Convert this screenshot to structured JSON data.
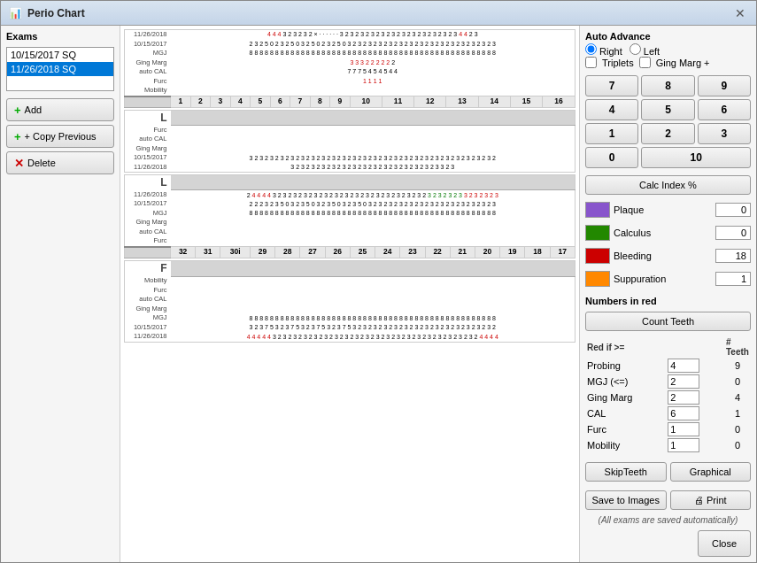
{
  "window": {
    "title": "Perio Chart",
    "icon": "📊"
  },
  "left_panel": {
    "exams_label": "Exams",
    "exam_items": [
      {
        "label": "10/15/2017  SQ",
        "selected": false
      },
      {
        "label": "11/26/2018  SQ",
        "selected": true
      }
    ],
    "add_btn": "Add",
    "copy_btn": "+ Copy Previous",
    "delete_btn": "Delete"
  },
  "right_panel": {
    "auto_advance_label": "Auto Advance",
    "right_label": "Right",
    "left_label": "Left",
    "triplets_label": "Triplets",
    "ging_marg_plus_label": "Ging Marg +",
    "numpad_keys": [
      "7",
      "8",
      "9",
      "4",
      "5",
      "6",
      "1",
      "2",
      "3",
      "0",
      "10"
    ],
    "calc_btn": "Calc Index %",
    "plaque_label": "Plaque",
    "plaque_value": "0",
    "plaque_color": "#8855cc",
    "calculus_label": "Calculus",
    "calculus_value": "0",
    "calculus_color": "#228800",
    "bleeding_label": "Bleeding",
    "bleeding_value": "18",
    "bleeding_color": "#cc0000",
    "suppuration_label": "Suppuration",
    "suppuration_value": "1",
    "suppuration_color": "#ff8800",
    "numbers_in_red_label": "Numbers in red",
    "count_teeth_btn": "Count Teeth",
    "red_if_label": "Red if >=",
    "teeth_label": "# Teeth",
    "red_rows": [
      {
        "label": "Probing",
        "value": "4",
        "teeth": "9"
      },
      {
        "label": "MGJ (<=)",
        "value": "2",
        "teeth": "0"
      },
      {
        "label": "Ging Marg",
        "value": "2",
        "teeth": "4"
      },
      {
        "label": "CAL",
        "value": "6",
        "teeth": "1"
      },
      {
        "label": "Furc",
        "value": "1",
        "teeth": "0"
      },
      {
        "label": "Mobility",
        "value": "1",
        "teeth": "0"
      }
    ],
    "skip_teeth_btn": "SkipTeeth",
    "graphical_btn": "Graphical",
    "save_to_images_btn": "Save to Images",
    "print_btn": "Print",
    "auto_save_note": "(All exams are saved automatically)"
  },
  "chart": {
    "upper_teeth_numbers": [
      "1",
      "2",
      "3",
      "4",
      "5",
      "6",
      "7",
      "8",
      "9",
      "10",
      "11",
      "12",
      "13",
      "14",
      "15",
      "16"
    ],
    "lower_teeth_numbers": [
      "32",
      "31",
      "30i",
      "29",
      "28",
      "27",
      "26",
      "25",
      "24",
      "23",
      "22",
      "21",
      "20",
      "19",
      "18",
      "17"
    ]
  }
}
